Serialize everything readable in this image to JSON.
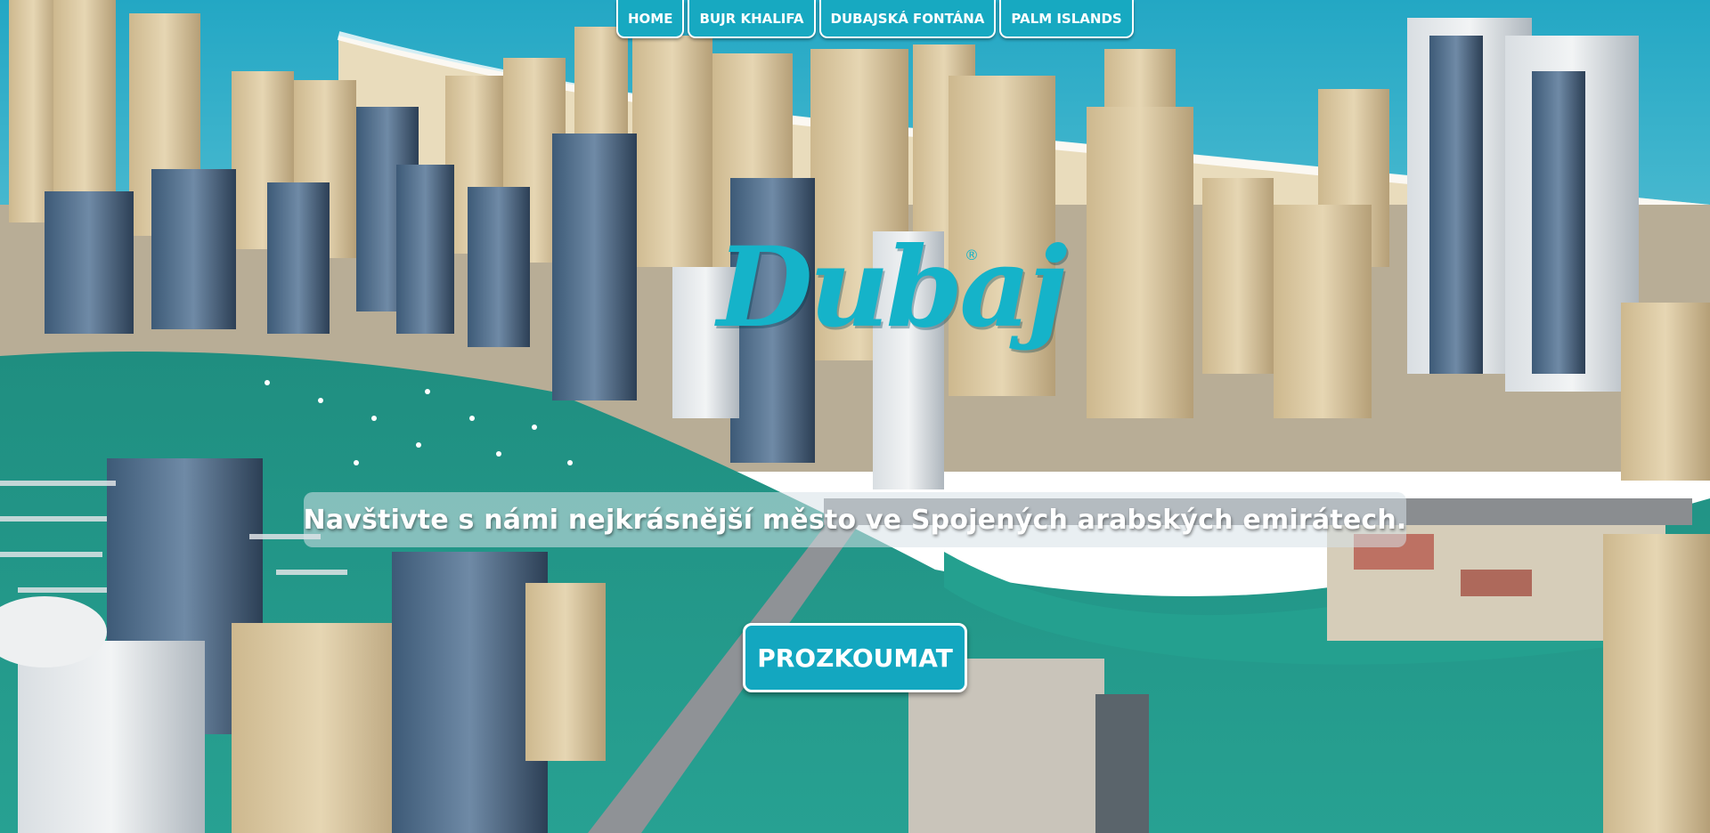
{
  "nav": {
    "items": [
      {
        "label": "HOME"
      },
      {
        "label": "BUJR KHALIFA"
      },
      {
        "label": "DUBAJSKÁ FONTÁNA"
      },
      {
        "label": "PALM ISLANDS"
      }
    ]
  },
  "hero": {
    "logo_text": "Dubaj",
    "logo_mark": "®",
    "tagline": "Navštivte s námi nejkrásnější město ve Spojených arabských emirátech.",
    "cta_label": "PROZKOUMAT"
  },
  "colors": {
    "accent": "#17a9c1",
    "logo": "#15b3c9",
    "sea": "#1f9a88",
    "sand": "#e8d9b5"
  }
}
